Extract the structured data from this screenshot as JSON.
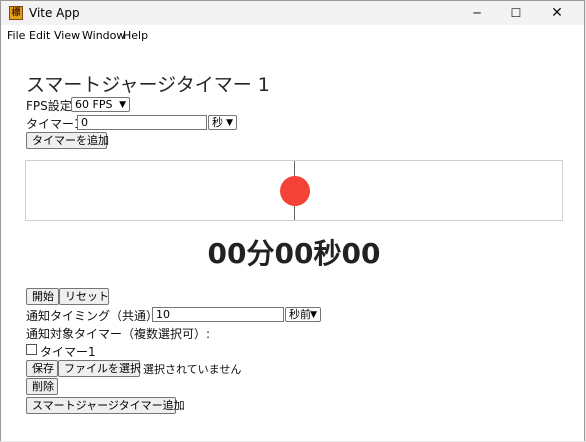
{
  "titlebar": {
    "app_title": "Vite App",
    "app_icon_glyph": "標",
    "minimize_glyph": "─",
    "maximize_glyph": "☐",
    "close_glyph": "✕"
  },
  "menubar": {
    "items": [
      "File",
      "Edit",
      "View",
      "Window",
      "Help"
    ]
  },
  "main": {
    "heading": "スマートジャージタイマー 1",
    "fps_label": "FPS設定:",
    "fps_select": "60 FPS",
    "timer1_label": "タイマー1",
    "timer1_value": "0",
    "timer1_unit": "秒",
    "add_timer_button": "タイマーを追加",
    "timer_display": "00分00秒00",
    "start_button": "開始",
    "reset_button": "リセット",
    "notify_label": "通知タイミング（共通）:",
    "notify_value": "10",
    "notify_unit": "秒前",
    "notify_targets_label": "通知対象タイマー（複数選択可）:",
    "checkbox_timer1_label": "タイマー1",
    "checkbox_timer1_checked": false,
    "save_button": "保存",
    "file_select_button": "ファイルを選択",
    "file_status": "選択されていません",
    "delete_button": "削除",
    "add_smart_timer_button": "スマートジャージタイマー追加"
  },
  "colors": {
    "ball": "#f44336",
    "heading": "#262626"
  }
}
